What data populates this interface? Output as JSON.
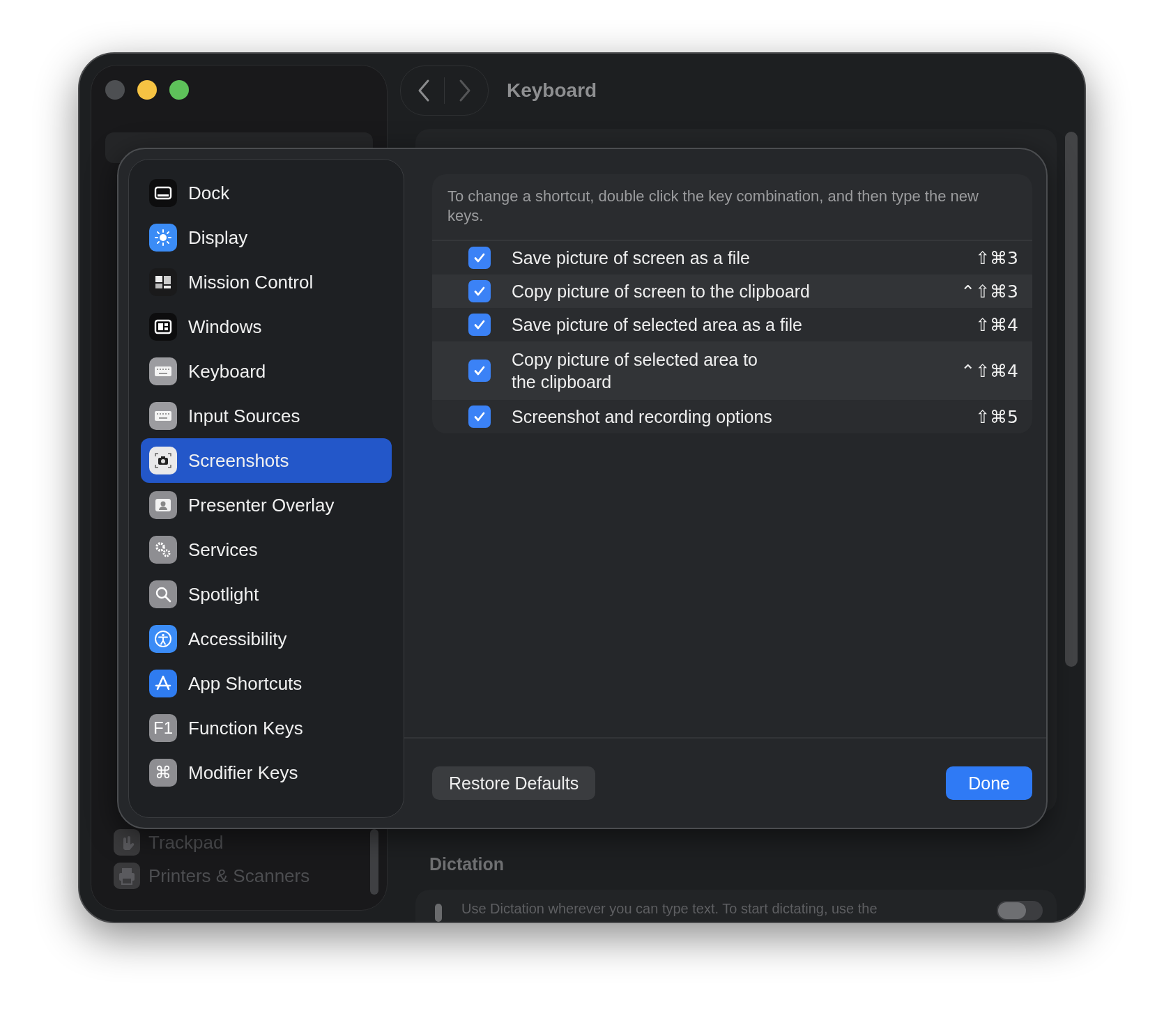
{
  "window": {
    "title": "Keyboard"
  },
  "background_sidebar": {
    "items": [
      {
        "label": "Trackpad",
        "kind": "trackpad"
      },
      {
        "label": "Printers & Scanners",
        "kind": "printer"
      }
    ]
  },
  "background_content": {
    "section_title": "Dictation",
    "dictation_text": "Use Dictation wherever you can type text. To start dictating, use the",
    "dictation_toggle": {
      "on": false
    }
  },
  "sheet": {
    "sidebar": {
      "items": [
        {
          "label": "Dock",
          "kind": "dock",
          "selected": false
        },
        {
          "label": "Display",
          "kind": "display",
          "selected": false
        },
        {
          "label": "Mission Control",
          "kind": "mission",
          "selected": false
        },
        {
          "label": "Windows",
          "kind": "windows",
          "selected": false
        },
        {
          "label": "Keyboard",
          "kind": "keyboard",
          "selected": false
        },
        {
          "label": "Input Sources",
          "kind": "keyboard",
          "selected": false
        },
        {
          "label": "Screenshots",
          "kind": "camera",
          "selected": true
        },
        {
          "label": "Presenter Overlay",
          "kind": "person",
          "selected": false
        },
        {
          "label": "Services",
          "kind": "gears",
          "selected": false
        },
        {
          "label": "Spotlight",
          "kind": "search",
          "selected": false
        },
        {
          "label": "Accessibility",
          "kind": "accessibility",
          "selected": false
        },
        {
          "label": "App Shortcuts",
          "kind": "appstore",
          "selected": false
        },
        {
          "label": "Function Keys",
          "kind": "glyph",
          "icon_text": "F1",
          "selected": false
        },
        {
          "label": "Modifier Keys",
          "kind": "glyph",
          "icon_text": "⌘",
          "selected": false
        }
      ]
    },
    "hint": "To change a shortcut, double click the key combination, and then type the new keys.",
    "shortcuts": [
      {
        "label": "Save picture of screen as a file",
        "checked": true,
        "keys": "⇧⌘3"
      },
      {
        "label": "Copy picture of screen to the clipboard",
        "checked": true,
        "keys": "⌃⇧⌘3"
      },
      {
        "label": "Save picture of selected area as a file",
        "checked": true,
        "keys": "⇧⌘4"
      },
      {
        "label": "Copy picture of selected area to the clipboard",
        "checked": true,
        "keys": "⌃⇧⌘4"
      },
      {
        "label": "Screenshot and recording options",
        "checked": true,
        "keys": "⇧⌘5"
      }
    ],
    "buttons": {
      "restore": "Restore Defaults",
      "done": "Done"
    }
  }
}
